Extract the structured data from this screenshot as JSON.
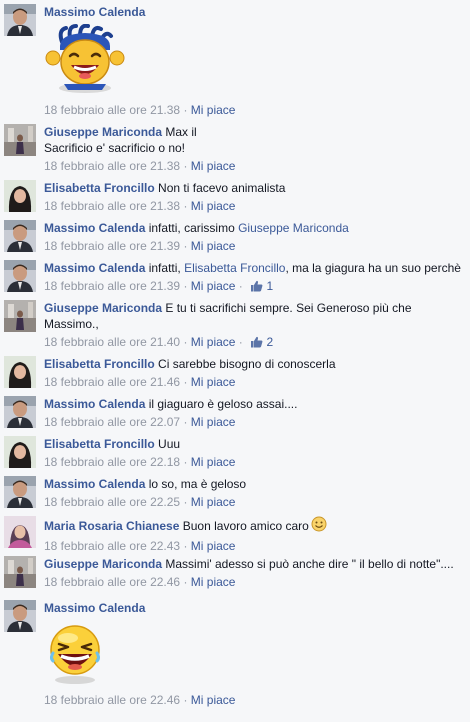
{
  "comments": [
    {
      "author": "Massimo Calenda",
      "parts": [],
      "time": "18 febbraio alle ore 21.38",
      "like": "Mi piace",
      "count": "",
      "sticker": "cheering-face-sticker"
    },
    {
      "author": "Giuseppe Mariconda",
      "parts": [
        {
          "t": "Max il"
        },
        {
          "br": true
        },
        {
          "t": "Sacrificio e' sacrificio o no!"
        }
      ],
      "time": "18 febbraio alle ore 21.38",
      "like": "Mi piace",
      "count": ""
    },
    {
      "author": "Elisabetta Froncillo",
      "parts": [
        {
          "t": "Non ti facevo animalista"
        }
      ],
      "time": "18 febbraio alle ore 21.38",
      "like": "Mi piace",
      "count": ""
    },
    {
      "author": "Massimo Calenda",
      "parts": [
        {
          "t": "infatti, carissimo "
        },
        {
          "m": "Giuseppe Mariconda"
        }
      ],
      "time": "18 febbraio alle ore 21.39",
      "like": "Mi piace",
      "count": ""
    },
    {
      "author": "Massimo Calenda",
      "parts": [
        {
          "t": "infatti, "
        },
        {
          "m": "Elisabetta Froncillo"
        },
        {
          "t": ", ma la giagura ha un suo perchè"
        }
      ],
      "time": "18 febbraio alle ore 21.39",
      "like": "Mi piace",
      "count": "1"
    },
    {
      "author": "Giuseppe Mariconda",
      "parts": [
        {
          "t": "E tu ti sacrifichi sempre. Sei Generoso più che"
        },
        {
          "br": true
        },
        {
          "t": "Massimo.,"
        }
      ],
      "time": "18 febbraio alle ore 21.40",
      "like": "Mi piace",
      "count": "2"
    },
    {
      "author": "Elisabetta Froncillo",
      "parts": [
        {
          "t": "Ci sarebbe bisogno di conoscerla"
        }
      ],
      "time": "18 febbraio alle ore 21.46",
      "like": "Mi piace",
      "count": ""
    },
    {
      "author": "Massimo Calenda",
      "parts": [
        {
          "t": "il giaguaro è geloso assai...."
        }
      ],
      "time": "18 febbraio alle ore 22.07",
      "like": "Mi piace",
      "count": ""
    },
    {
      "author": "Elisabetta Froncillo",
      "parts": [
        {
          "t": "Uuu"
        }
      ],
      "time": "18 febbraio alle ore 22.18",
      "like": "Mi piace",
      "count": ""
    },
    {
      "author": "Massimo Calenda",
      "parts": [
        {
          "t": "lo so, ma è geloso"
        }
      ],
      "time": "18 febbraio alle ore 22.25",
      "like": "Mi piace",
      "count": ""
    },
    {
      "author": "Maria Rosaria Chianese",
      "parts": [
        {
          "t": "Buon lavoro amico caro"
        }
      ],
      "time": "18 febbraio alle ore 22.43",
      "like": "Mi piace",
      "count": "",
      "emoji": "smile-emoticon"
    },
    {
      "author": "Giuseppe Mariconda",
      "parts": [
        {
          "t": "Massimi' adesso si può anche dire \" il bello di notte\"...."
        }
      ],
      "time": "18 febbraio alle ore 22.46",
      "like": "Mi piace",
      "count": ""
    },
    {
      "author": "Massimo Calenda",
      "parts": [],
      "time": "18 febbraio alle ore 22.46",
      "like": "Mi piace",
      "count": "",
      "sticker": "laughing-face-sticker"
    }
  ],
  "colors": {
    "link": "#3b5998",
    "meta": "#9197a3",
    "text": "#141823",
    "background": "#f6f7f9"
  }
}
